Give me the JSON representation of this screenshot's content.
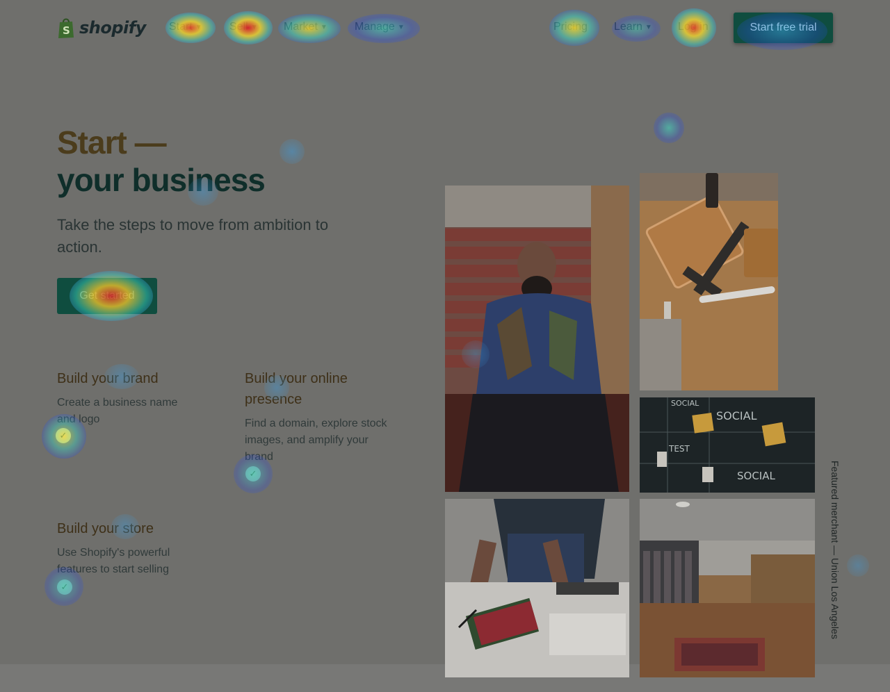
{
  "header": {
    "logo_text": "shopify",
    "nav": [
      {
        "label": "Start",
        "has_dropdown": true
      },
      {
        "label": "Sell",
        "has_dropdown": true
      },
      {
        "label": "Market",
        "has_dropdown": true
      },
      {
        "label": "Manage",
        "has_dropdown": true
      }
    ],
    "right_nav": [
      {
        "label": "Pricing",
        "has_dropdown": false
      },
      {
        "label": "Learn",
        "has_dropdown": true
      },
      {
        "label": "Log in",
        "has_dropdown": false
      }
    ],
    "trial_button": "Start free trial"
  },
  "hero": {
    "title_line1": "Start —",
    "title_line2": "your business",
    "subtitle": "Take the steps to move from ambition to action.",
    "cta": "Get started"
  },
  "features": [
    {
      "title": "Build your brand",
      "desc": "Create a business name and logo"
    },
    {
      "title": "Build your online presence",
      "desc": "Find a domain, explore stock images, and amplify your brand"
    },
    {
      "title": "Build your store",
      "desc": "Use Shopify's powerful features to start selling"
    }
  ],
  "photos": {
    "caption": "Featured merchant — Union Los Angeles",
    "chalkboard_words": [
      "SOCIAL",
      "SOCIAL",
      "TEST",
      "SOCIAL"
    ]
  },
  "icons": {
    "chevron": "chevron-down-icon",
    "check": "check-icon",
    "logo": "shopify-bag-icon"
  },
  "colors": {
    "brand_green": "#0f4d3f",
    "overlay_grey": "#6f6f6c",
    "title_brown": "#4b3c1c"
  }
}
